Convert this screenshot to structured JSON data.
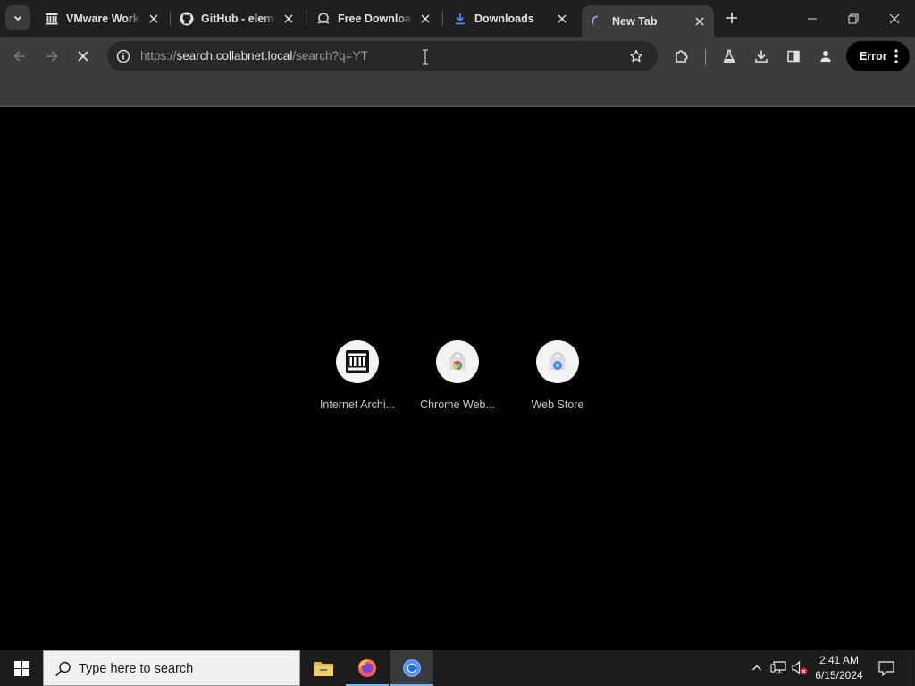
{
  "tabs": [
    {
      "title": "VMware Workstation",
      "icon": "internet-archive-icon",
      "active": false
    },
    {
      "title": "GitHub - element",
      "icon": "github-icon",
      "active": false
    },
    {
      "title": "Free Download",
      "icon": "download-site-icon",
      "active": false
    },
    {
      "title": "Downloads",
      "icon": "download-arrow-icon",
      "active": false
    },
    {
      "title": "New Tab",
      "icon": "loading-spinner-icon",
      "active": true
    }
  ],
  "omnibox": {
    "url_scheme": "https://",
    "url_host": "search.collabnet.local",
    "url_path": "/search?q=YT"
  },
  "profile": {
    "error_label": "Error"
  },
  "shortcuts": [
    {
      "label": "Internet Archi...",
      "icon": "internet-archive-icon"
    },
    {
      "label": "Chrome Web...",
      "icon": "chrome-web-store-icon"
    },
    {
      "label": "Web Store",
      "icon": "web-store-icon"
    }
  ],
  "taskbar": {
    "search_placeholder": "Type here to search",
    "apps": [
      "file-explorer-icon",
      "firefox-icon",
      "chrome-icon"
    ],
    "active_app": "chrome-icon",
    "time": "2:41 AM",
    "date": "6/15/2024"
  },
  "colors": {
    "tabstrip_bg": "#1f1f1f",
    "toolbar_bg": "#3c3c3c",
    "omnibox_bg": "#282828",
    "content_bg": "#000000",
    "taskbar_bg": "#1c1c1c",
    "accent_blue": "#76b9ed"
  }
}
